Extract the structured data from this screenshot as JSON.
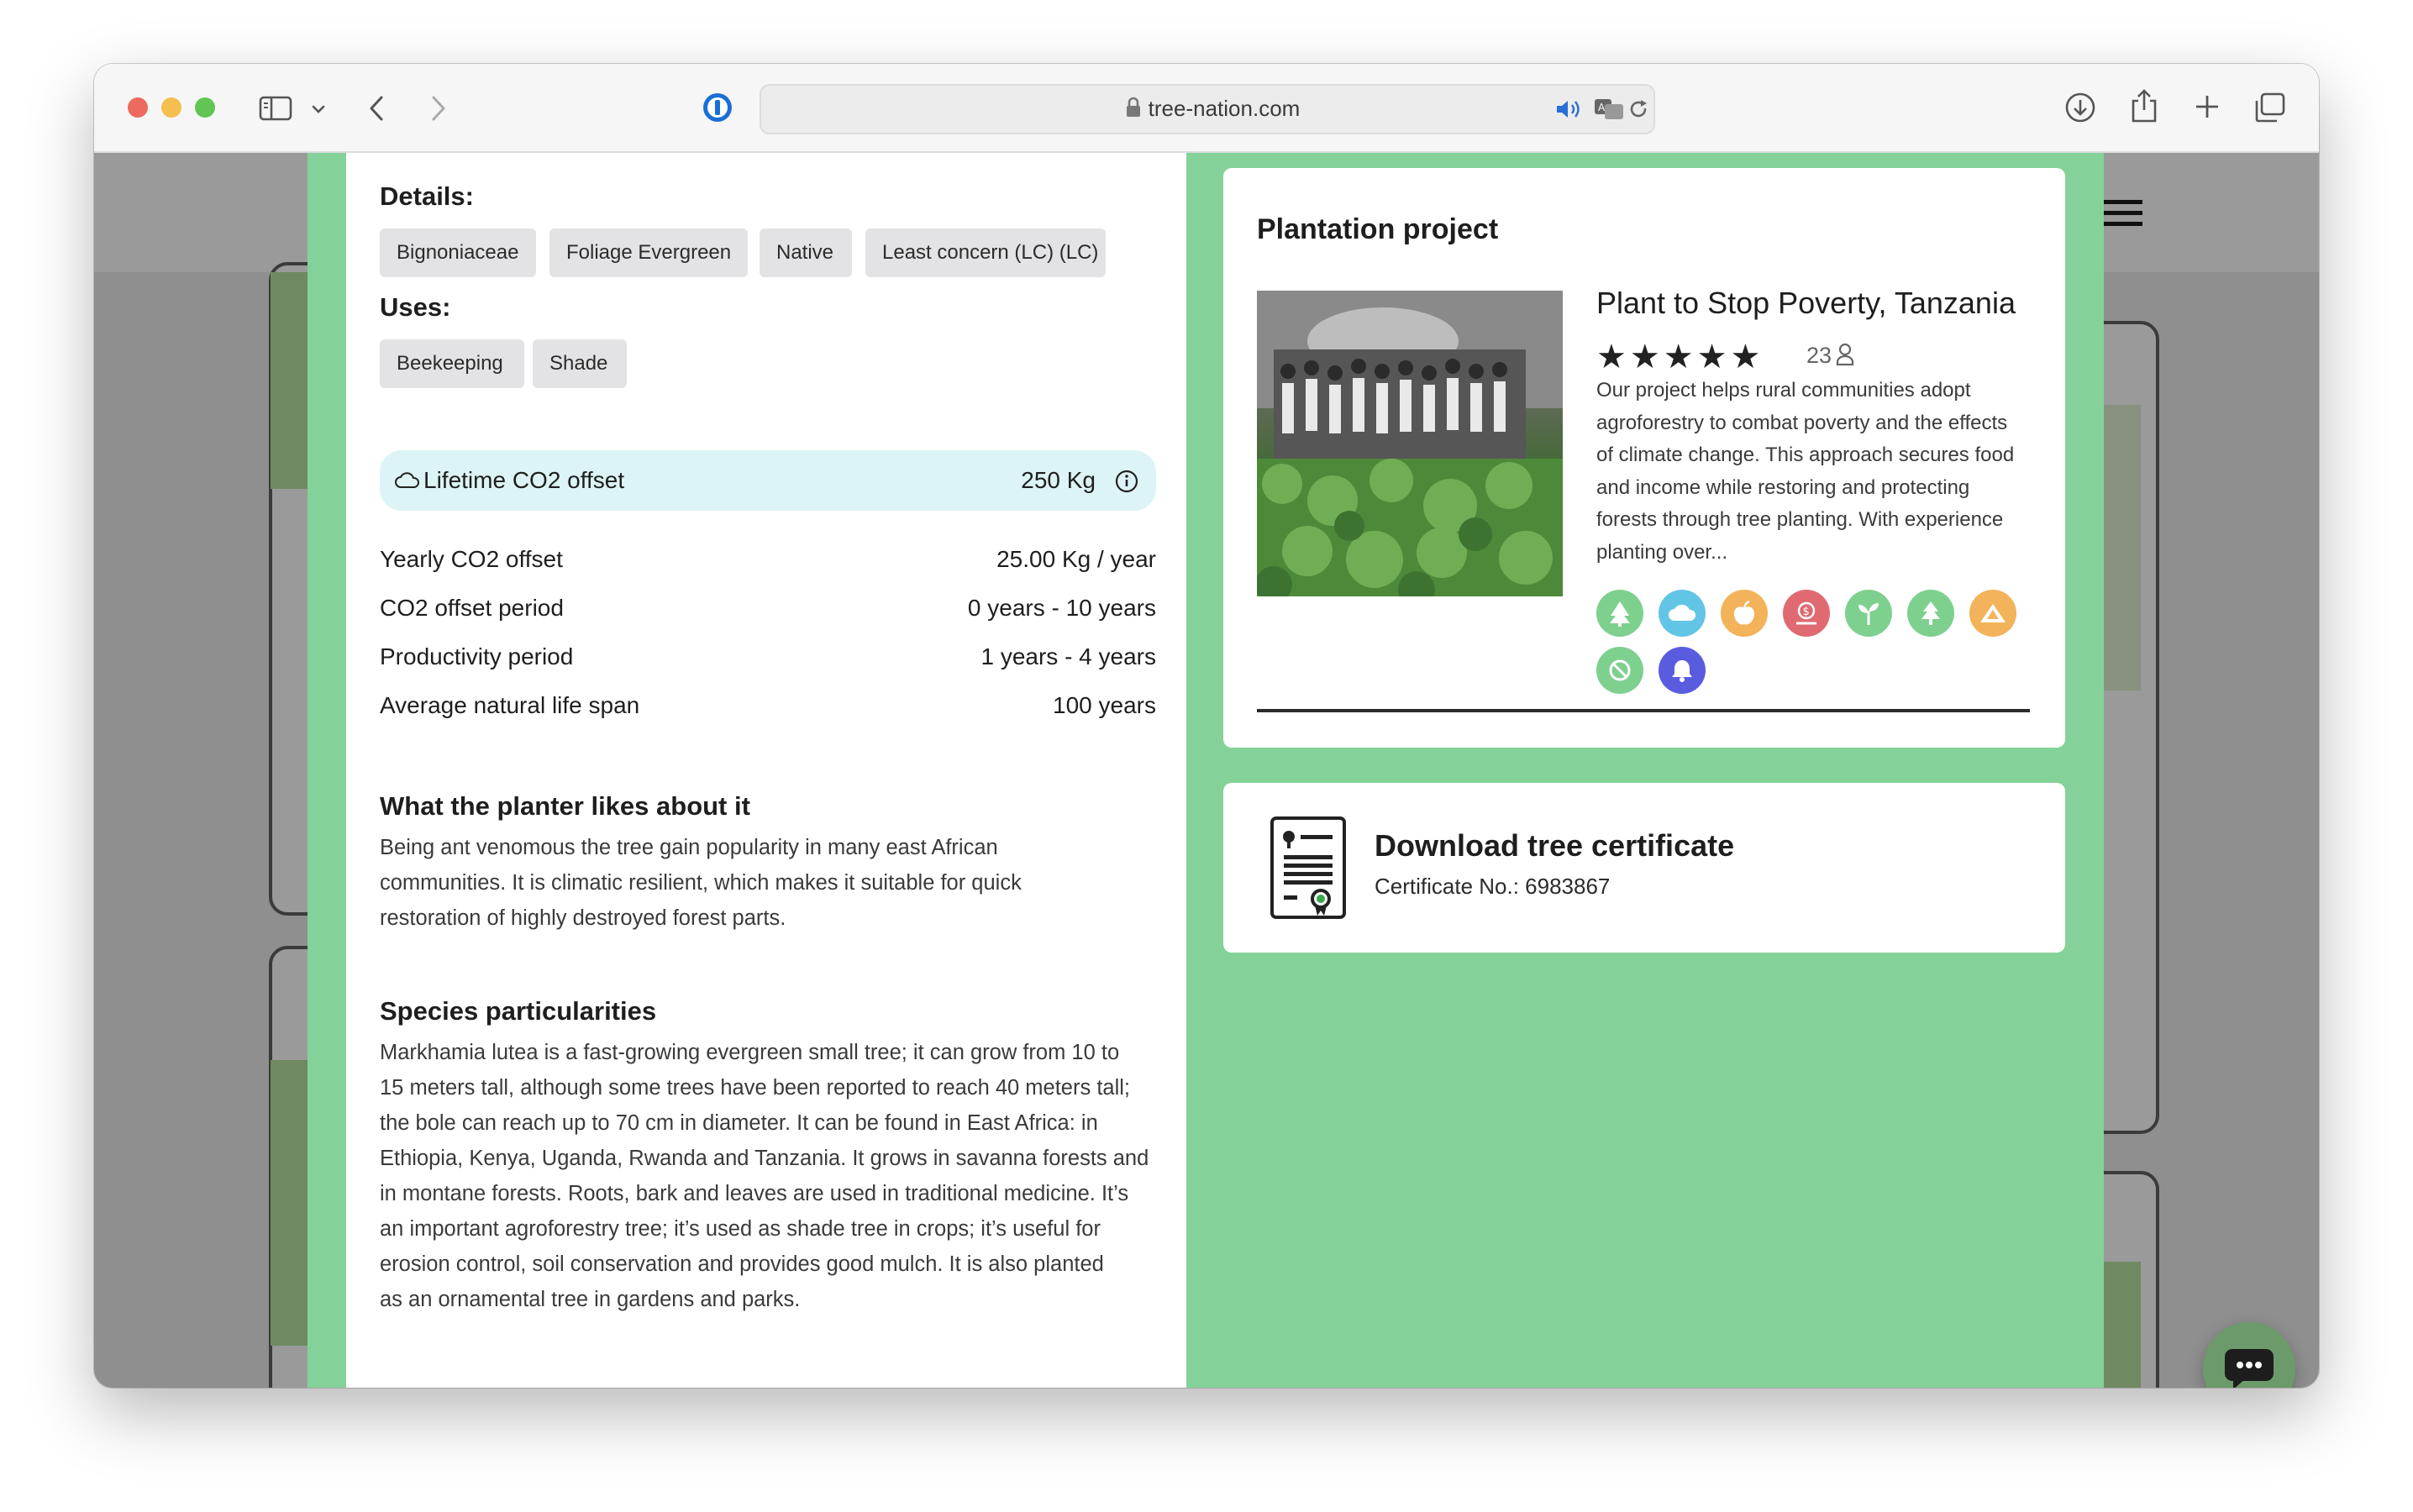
{
  "browser": {
    "url": "tree-nation.com",
    "colors": {
      "close": "#ed6a5e",
      "minimize": "#f5bf4f",
      "maximize": "#61c554"
    }
  },
  "details": {
    "title": "Details:",
    "tags": [
      "Bignoniaceae",
      "Foliage Evergreen",
      "Native",
      "Least concern (LC) (LC)"
    ]
  },
  "uses": {
    "title": "Uses:",
    "tags": [
      "Beekeeping",
      "Shade"
    ]
  },
  "co2": {
    "lifetime_label": "Lifetime CO2 offset",
    "lifetime_value": "250 Kg",
    "rows": [
      {
        "label": "Yearly CO2 offset",
        "value": "25.00 Kg / year"
      },
      {
        "label": "CO2 offset period",
        "value": "0 years - 10 years"
      },
      {
        "label": "Productivity period",
        "value": "1 years - 4 years"
      },
      {
        "label": "Average natural life span",
        "value": "100 years"
      }
    ]
  },
  "planter": {
    "title": "What the planter likes about it",
    "lines": [
      "Being ant venomous the tree gain popularity in many east African",
      "communities. It is climatic resilient, which makes it suitable for quick",
      "restoration of highly destroyed forest parts."
    ]
  },
  "particularities": {
    "title": "Species particularities",
    "lines": [
      "Markhamia lutea is a fast-growing evergreen small tree; it can grow from 10 to",
      "15 meters tall, although some trees have been reported to reach 40 meters tall;",
      "the bole can reach up to 70 cm in diameter. It can be found in East Africa: in",
      "Ethiopia, Kenya, Uganda, Rwanda and Tanzania. It grows in savanna forests and",
      "in montane forests. Roots, bark and leaves are used in traditional medicine. It’s",
      "an important agroforestry tree; it’s used as shade tree in crops; it’s useful for",
      "erosion control, soil conservation and provides good mulch. It is also planted",
      "as an ornamental tree in gardens and parks."
    ]
  },
  "plantation": {
    "section_title": "Plantation project",
    "project_name": "Plant to Stop Poverty, Tanzania",
    "rating": 5,
    "review_count": "23",
    "description_lines": [
      "Our project helps rural communities adopt",
      "agroforestry to combat poverty and the effects",
      "of climate change. This approach secures food",
      "and income while restoring and protecting",
      "forests through tree planting. With experience",
      "planting over..."
    ],
    "impact_icons": [
      {
        "name": "tree-icon",
        "color": "#7ed08f"
      },
      {
        "name": "cloud-icon",
        "color": "#63c5e6"
      },
      {
        "name": "apple-icon",
        "color": "#f3b35a"
      },
      {
        "name": "money-icon",
        "color": "#e06a72"
      },
      {
        "name": "sprout-icon",
        "color": "#7ed08f"
      },
      {
        "name": "pine-tree-icon",
        "color": "#7ed08f"
      },
      {
        "name": "mountain-icon",
        "color": "#f3b35a"
      },
      {
        "name": "ban-icon",
        "color": "#7ed08f"
      },
      {
        "name": "bell-icon",
        "color": "#5a5ce0"
      }
    ]
  },
  "certificate": {
    "title": "Download tree certificate",
    "number": "Certificate No.: 6983867"
  },
  "theme": {
    "modal_green": "#84d299",
    "co2_bar": "#dcf4f5",
    "tag_bg": "#e3e3e5"
  }
}
